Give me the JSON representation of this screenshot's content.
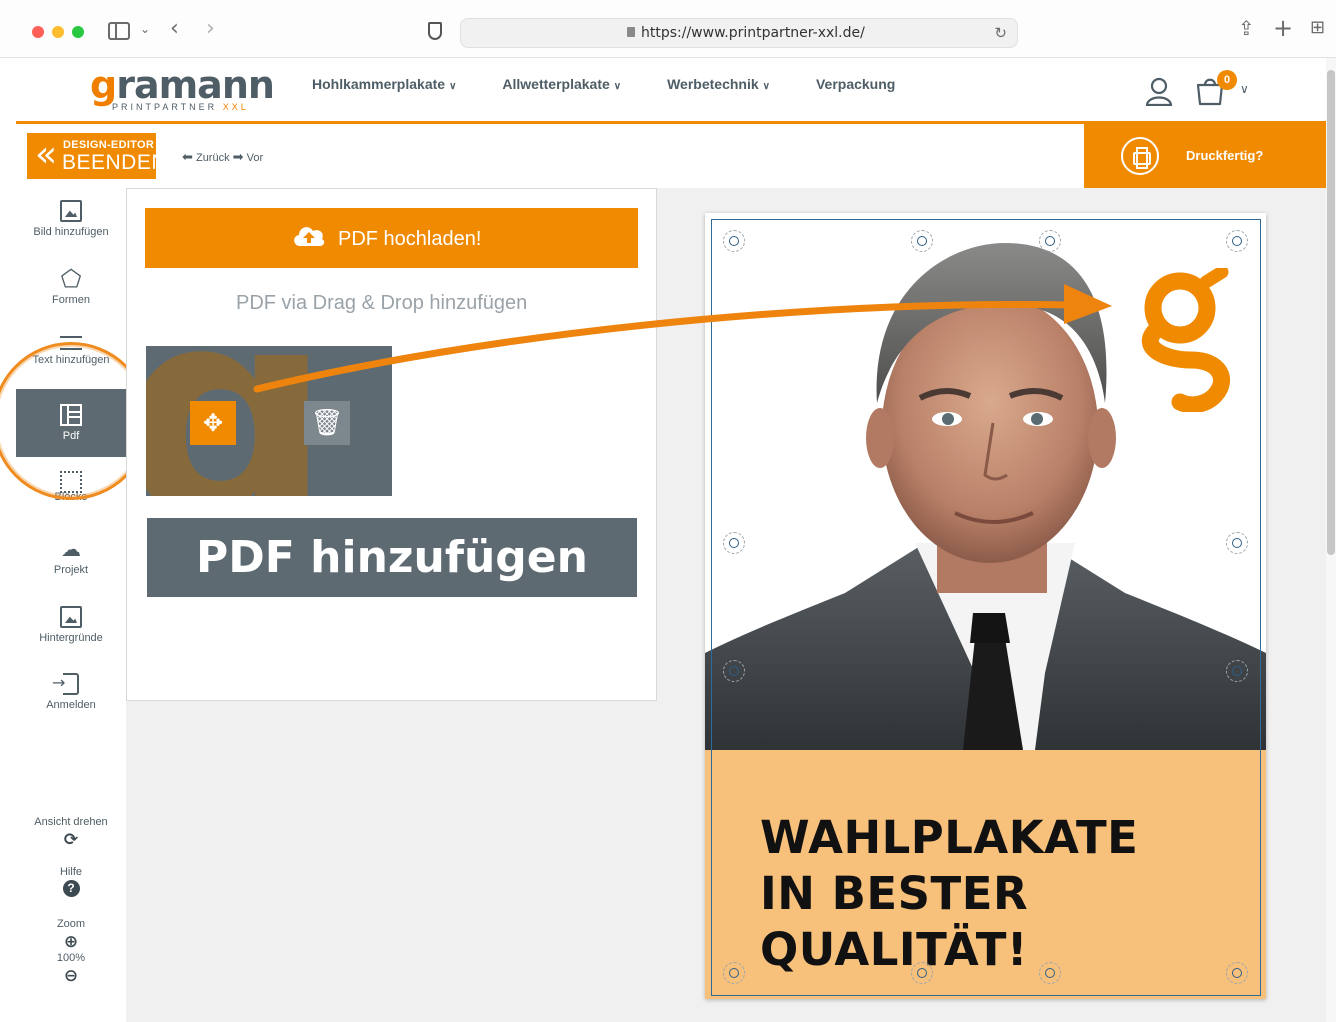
{
  "browser": {
    "url": "https://www.printpartner-xxl.de/"
  },
  "site": {
    "logo_main_prefix": "g",
    "logo_main_rest": "ramann",
    "logo_sub": "PRINTPARTNER",
    "logo_sub_accent": "XXL",
    "nav": [
      {
        "label": "Hohlkammerplakate"
      },
      {
        "label": "Allwetterplakate"
      },
      {
        "label": "Werbetechnik"
      },
      {
        "label": "Verpackung"
      }
    ],
    "cart_count": "0"
  },
  "editor": {
    "exit_small": "DESIGN-EDITOR",
    "exit_big": "BEENDEN",
    "undo_label": "Zurück",
    "redo_label": "Vor",
    "print_ready_label": "Druckfertig?",
    "tools": [
      {
        "label": "Bild hinzufügen",
        "icon": "image-icon"
      },
      {
        "label": "Formen",
        "icon": "pentagon-icon"
      },
      {
        "label": "Text hinzufügen",
        "icon": "text-frame-icon"
      },
      {
        "label": "Pdf",
        "icon": "pdf-panel-icon"
      },
      {
        "label": "Blöcke",
        "icon": "crop-frame-icon"
      },
      {
        "label": "Projekt",
        "icon": "cloud-download-icon"
      },
      {
        "label": "Hintergründe",
        "icon": "landscape-icon"
      },
      {
        "label": "Anmelden",
        "icon": "sign-in-icon"
      }
    ],
    "footer": {
      "rotate_label": "Ansicht drehen",
      "help_label": "Hilfe",
      "zoom_label": "Zoom",
      "zoom_value": "100%"
    }
  },
  "pdf_panel": {
    "upload_label": "PDF hochladen!",
    "dropzone_label": "PDF via Drag & Drop hinzufügen",
    "callout": "PDF hinzufügen"
  },
  "poster": {
    "headline_line1": "WAHLPLAKATE",
    "headline_line2": "IN BESTER QUALITÄT!"
  },
  "colors": {
    "accent": "#f08a00",
    "slate": "#5e6a72",
    "band": "#f7c07b"
  }
}
